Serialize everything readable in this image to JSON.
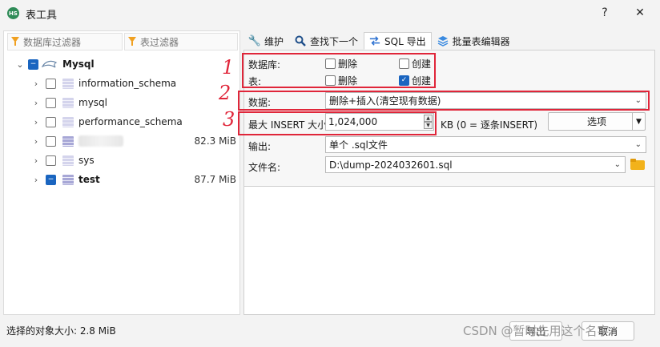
{
  "window": {
    "title": "表工具",
    "help_label": "?",
    "close_label": "✕"
  },
  "filters": {
    "db_placeholder": "数据库过滤器",
    "table_placeholder": "表过滤器"
  },
  "tree": {
    "root": "Mysql",
    "items": [
      {
        "label": "information_schema",
        "size": ""
      },
      {
        "label": "mysql",
        "size": ""
      },
      {
        "label": "performance_schema",
        "size": ""
      },
      {
        "label": "",
        "size": "82.3 MiB"
      },
      {
        "label": "sys",
        "size": ""
      },
      {
        "label": "test",
        "size": "87.7 MiB"
      }
    ]
  },
  "status": {
    "selected_size": "选择的对象大小: 2.8 MiB"
  },
  "tabs": [
    {
      "label": "维护"
    },
    {
      "label": "查找下一个"
    },
    {
      "label": "SQL 导出"
    },
    {
      "label": "批量表编辑器"
    }
  ],
  "form": {
    "database_label": "数据库:",
    "table_label": "表:",
    "drop_label": "删除",
    "create_label": "创建",
    "db_drop": false,
    "db_create": false,
    "table_drop": false,
    "table_create": true,
    "data_label": "数据:",
    "data_value": "删除+插入(清空现有数据)",
    "max_insert_label": "最大 INSERT 大小:",
    "max_insert_value": "1,024,000",
    "kb_note": "KB (0 = 逐条INSERT)",
    "options_button": "选项",
    "output_label": "输出:",
    "output_value": "单个 .sql文件",
    "filename_label": "文件名:",
    "filename_value": "D:\\dump-2024032601.sql"
  },
  "annotations": [
    "1",
    "2",
    "3"
  ],
  "footer": {
    "export_button": "导出",
    "cancel_button": "取消",
    "watermark": "CSDN @暂时先用这个名字"
  },
  "colors": {
    "accent": "#1a65c0",
    "highlight": "#e0263a",
    "folder": "#f2b21b"
  }
}
